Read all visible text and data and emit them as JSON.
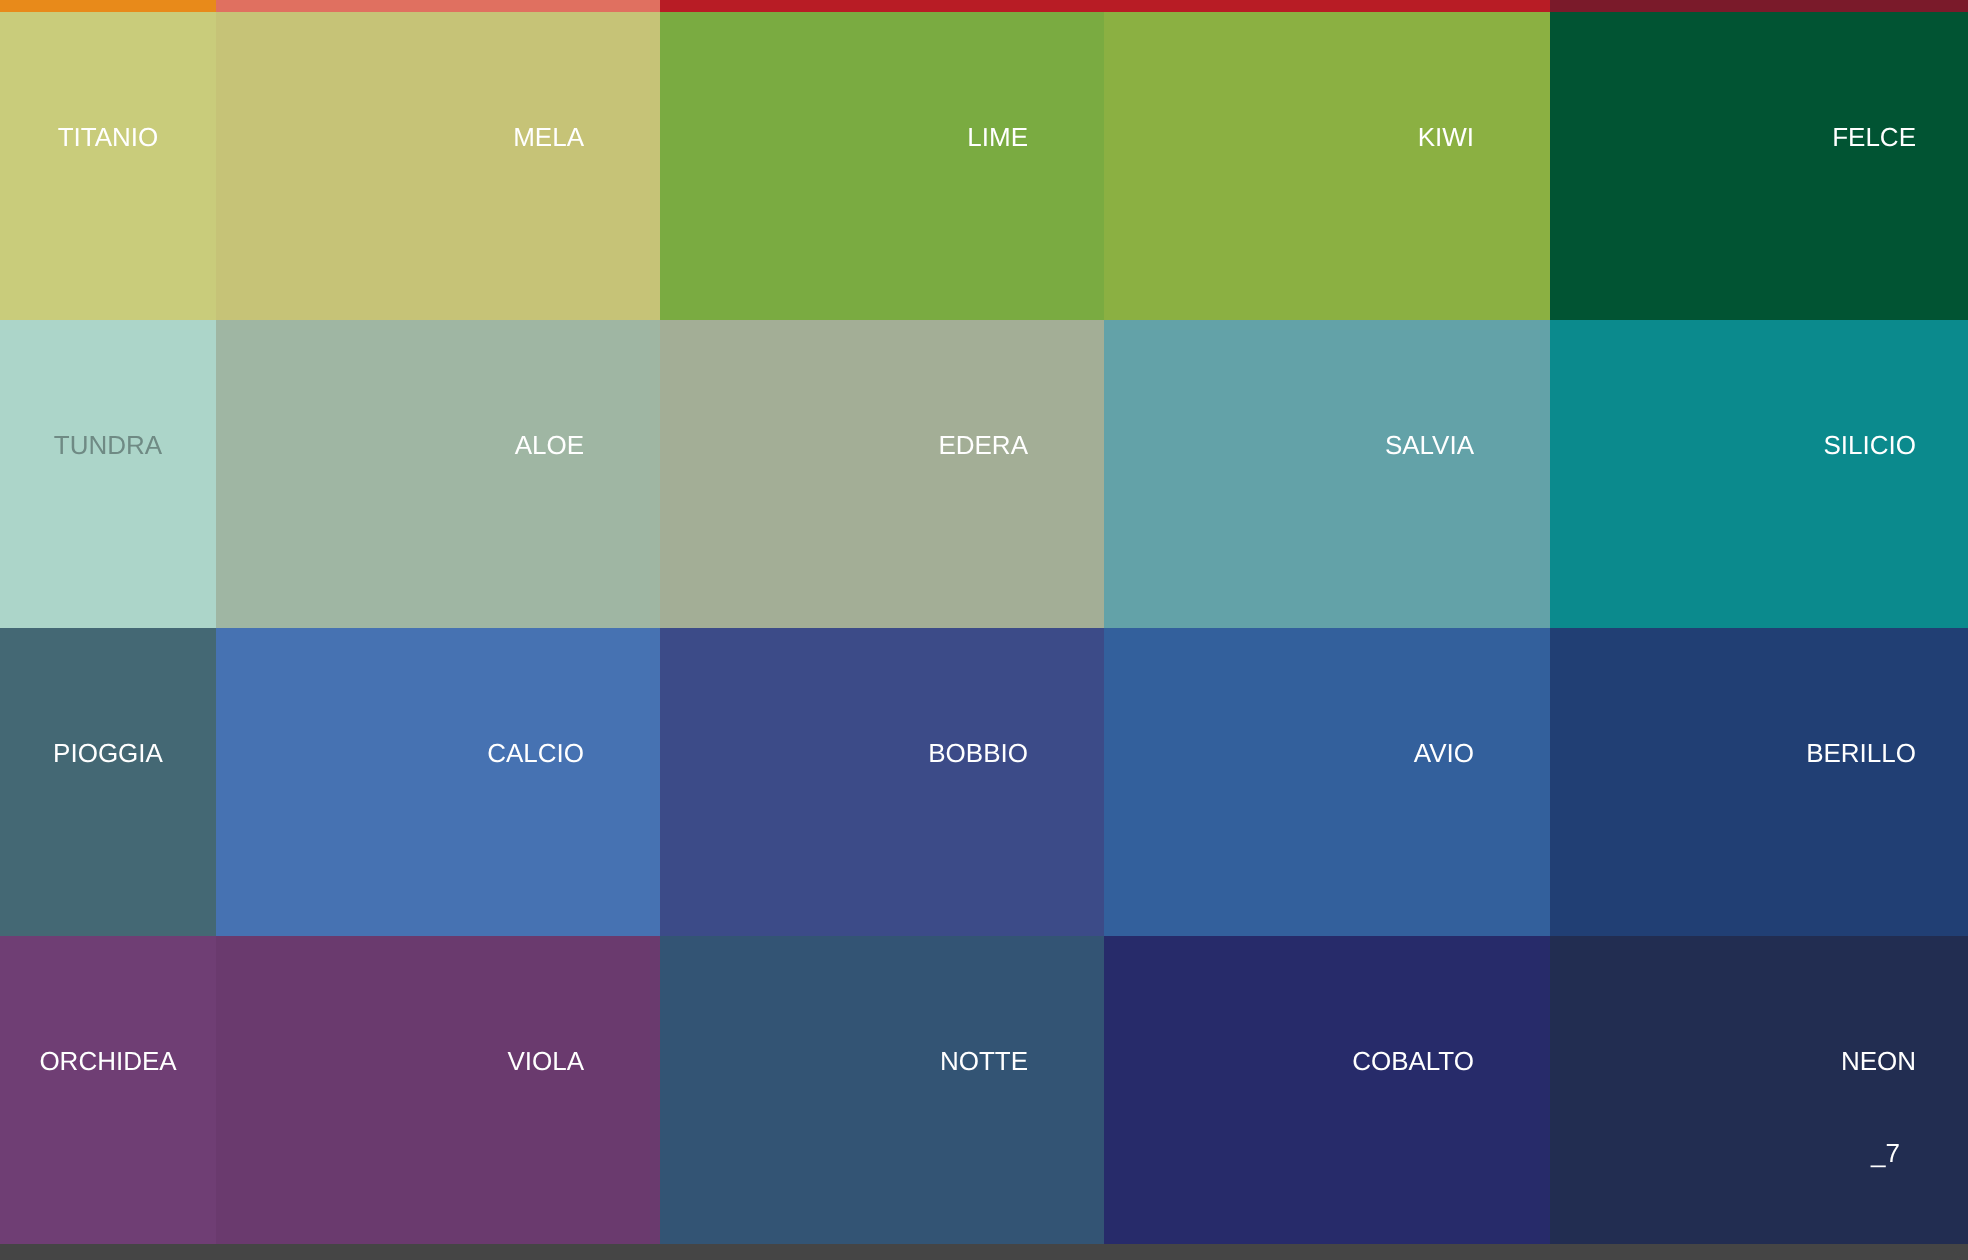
{
  "top_strip": [
    {
      "color": "#e88a1a"
    },
    {
      "color": "#e07060"
    },
    {
      "color": "#b81c25"
    },
    {
      "color": "#7a1a2a"
    }
  ],
  "swatch_rows": [
    {
      "swatches": [
        {
          "name": "TITANIO",
          "color": "#c9cc7b"
        },
        {
          "name": "MELA",
          "color": "#c6c377"
        },
        {
          "name": "LIME",
          "color": "#7aab41"
        },
        {
          "name": "KIWI",
          "color": "#8bb042"
        },
        {
          "name": "FELCE",
          "color": "#015433"
        }
      ]
    },
    {
      "swatches": [
        {
          "name": "TUNDRA",
          "color": "#acd5c9"
        },
        {
          "name": "ALOE",
          "color": "#9fb6a3"
        },
        {
          "name": "EDERA",
          "color": "#a3ae96"
        },
        {
          "name": "SALVIA",
          "color": "#63a2a8"
        },
        {
          "name": "SILICIO",
          "color": "#0b8a8d"
        }
      ]
    },
    {
      "swatches": [
        {
          "name": "PIOGGIA",
          "color": "#446874"
        },
        {
          "name": "CALCIO",
          "color": "#4672b2"
        },
        {
          "name": "BOBBIO",
          "color": "#3c4b88"
        },
        {
          "name": "AVIO",
          "color": "#33609c"
        },
        {
          "name": "BERILLO",
          "color": "#213f74"
        }
      ]
    },
    {
      "swatches": [
        {
          "name": "ORCHIDEA",
          "color": "#6f3e74"
        },
        {
          "name": "VIOLA",
          "color": "#6a3a6e"
        },
        {
          "name": "NOTTE",
          "color": "#335474"
        },
        {
          "name": "COBALTO",
          "color": "#272b6a"
        },
        {
          "name": "NEON",
          "color": "#222d51",
          "note": "_7"
        }
      ]
    }
  ]
}
